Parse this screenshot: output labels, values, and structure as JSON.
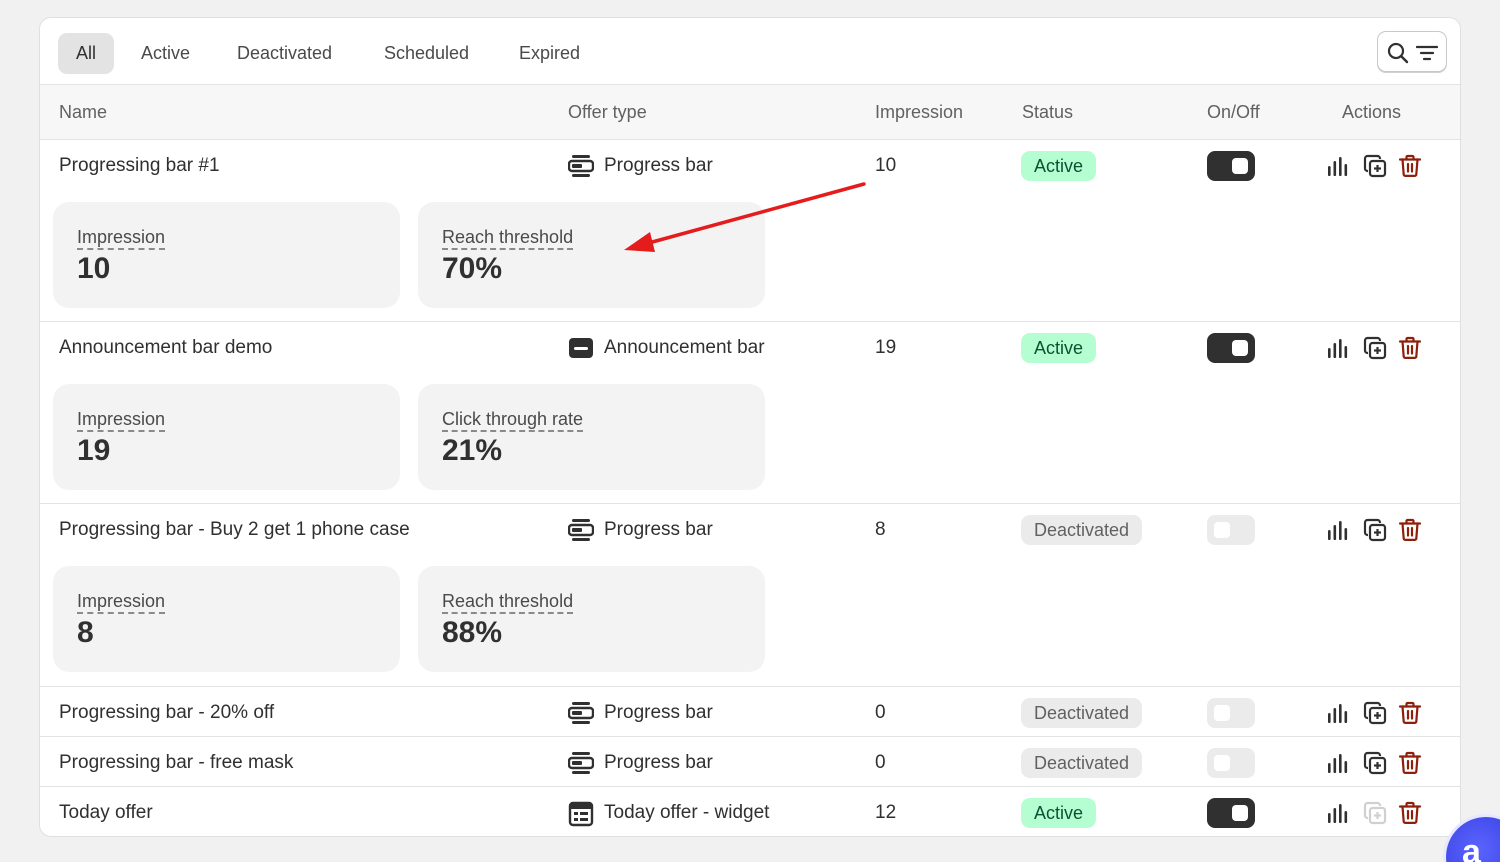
{
  "tabs": [
    {
      "label": "All",
      "selected": true
    },
    {
      "label": "Active",
      "selected": false
    },
    {
      "label": "Deactivated",
      "selected": false
    },
    {
      "label": "Scheduled",
      "selected": false
    },
    {
      "label": "Expired",
      "selected": false
    }
  ],
  "columns": {
    "name": "Name",
    "offer_type": "Offer type",
    "impression": "Impression",
    "status": "Status",
    "onoff": "On/Off",
    "actions": "Actions"
  },
  "rows": [
    {
      "name": "Progressing bar #1",
      "offer_type": "Progress bar",
      "offer_icon": "progress-bar-icon",
      "impression": "10",
      "status": "Active",
      "on": true,
      "metrics": [
        {
          "label": "Impression",
          "value": "10"
        },
        {
          "label": "Reach threshold",
          "value": "70%"
        }
      ]
    },
    {
      "name": "Announcement bar demo",
      "offer_type": "Announcement bar",
      "offer_icon": "announcement-bar-icon",
      "impression": "19",
      "status": "Active",
      "on": true,
      "metrics": [
        {
          "label": "Impression",
          "value": "19"
        },
        {
          "label": "Click through rate",
          "value": "21%"
        }
      ]
    },
    {
      "name": "Progressing bar - Buy 2 get 1 phone case",
      "offer_type": "Progress bar",
      "offer_icon": "progress-bar-icon",
      "impression": "8",
      "status": "Deactivated",
      "on": false,
      "metrics": [
        {
          "label": "Impression",
          "value": "8"
        },
        {
          "label": "Reach threshold",
          "value": "88%"
        }
      ]
    },
    {
      "name": "Progressing bar - 20% off",
      "offer_type": "Progress bar",
      "offer_icon": "progress-bar-icon",
      "impression": "0",
      "status": "Deactivated",
      "on": false
    },
    {
      "name": "Progressing bar - free mask",
      "offer_type": "Progress bar",
      "offer_icon": "progress-bar-icon",
      "impression": "0",
      "status": "Deactivated",
      "on": false
    },
    {
      "name": "Today offer",
      "offer_type": "Today offer - widget",
      "offer_icon": "calendar-widget-icon",
      "impression": "12",
      "status": "Active",
      "on": true,
      "duplicate_disabled": true
    }
  ],
  "icons": {
    "search": "search-icon",
    "filter": "filter-icon",
    "analytics": "bar-chart-icon",
    "duplicate": "duplicate-icon",
    "delete": "trash-icon",
    "chat": "chat-launcher-icon"
  },
  "colors": {
    "active_badge_bg": "#b4fed2",
    "active_badge_text": "#0c5132",
    "deactivated_badge_bg": "#ebebeb",
    "delete_icon": "#8e1f0b",
    "annotation_arrow": "#e51c1c"
  },
  "chat_launcher_text": "a"
}
